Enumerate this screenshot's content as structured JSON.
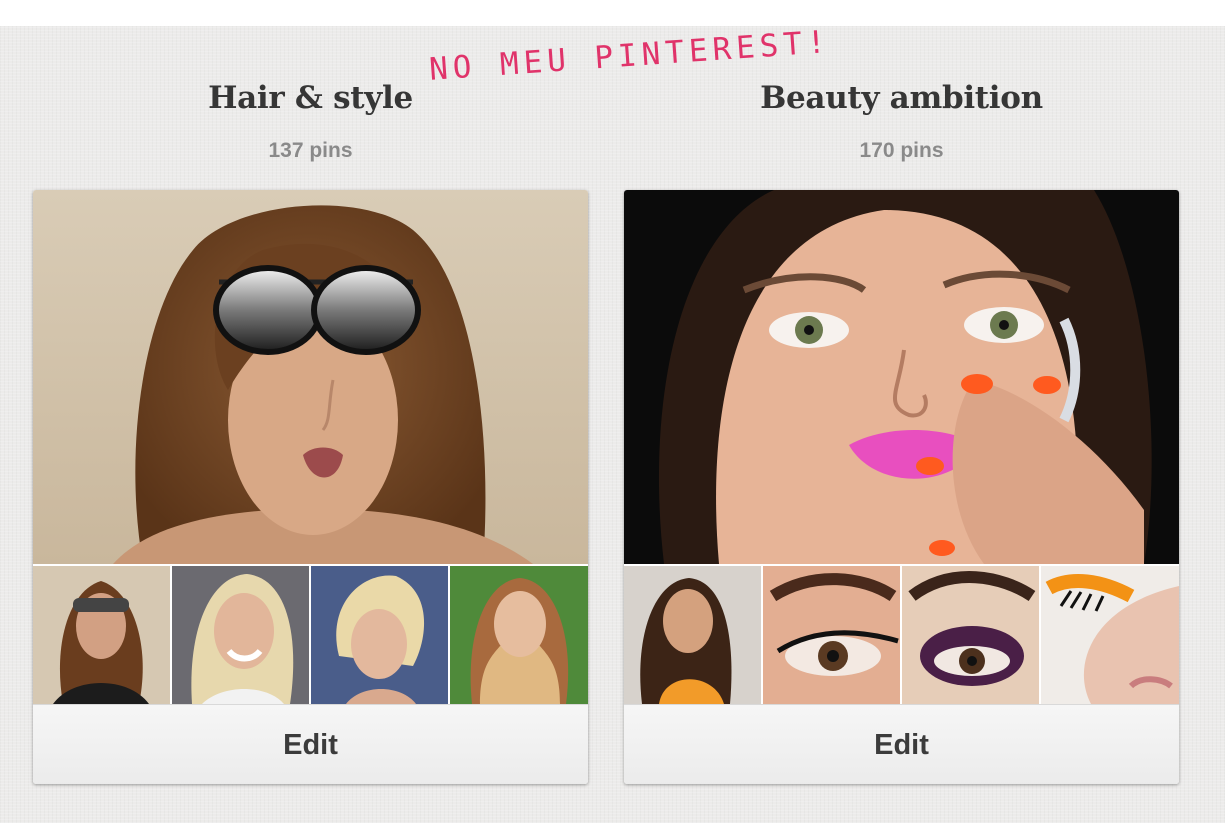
{
  "overlay": {
    "handwritten_text": "NO MEU PINTEREST!"
  },
  "boards": [
    {
      "title": "Hair & style",
      "pin_count": "137 pins",
      "edit_label": "Edit",
      "cover_image": "woman-with-mirrored-aviator-sunglasses",
      "thumbnails": [
        "woman-with-sunglasses",
        "blonde-woman-smiling",
        "blonde-updo-profile",
        "woman-with-long-ombre-hair"
      ]
    },
    {
      "title": "Beauty ambition",
      "pin_count": "170 pins",
      "edit_label": "Edit",
      "cover_image": "model-with-pink-lipstick-and-orange-nails",
      "thumbnails": [
        "brunette-woman-in-orange-top",
        "winged-eyeliner-closeup",
        "smoky-purple-eye-makeup",
        "orange-eyeshadow-lashes"
      ]
    }
  ],
  "colors": {
    "handwritten": "#e0336a",
    "title": "#363636",
    "count": "#8a8a8a",
    "background": "#ecebea"
  }
}
